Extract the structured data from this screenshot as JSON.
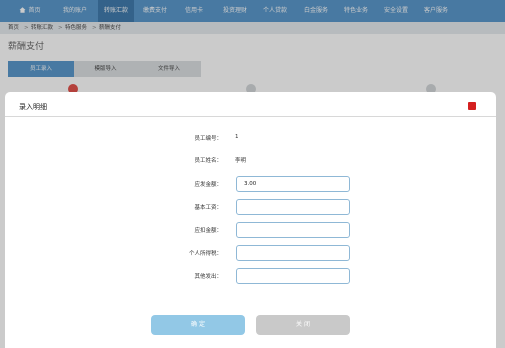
{
  "nav": {
    "items": [
      {
        "label": "首页",
        "icon": "home-icon"
      },
      {
        "label": "我的账户"
      },
      {
        "label": "转账汇款",
        "active": true
      },
      {
        "label": "缴费支付"
      },
      {
        "label": "信用卡"
      },
      {
        "label": "投资理财"
      },
      {
        "label": "个人贷款"
      },
      {
        "label": "白金服务"
      },
      {
        "label": "特色业务"
      },
      {
        "label": "安全设置"
      },
      {
        "label": "客户服务"
      }
    ]
  },
  "breadcrumb": [
    "首页",
    "转账汇款",
    "特色服务",
    "薪酬支付"
  ],
  "page": {
    "title": "薪酬支付",
    "tabs": [
      "员工录入",
      "模版导入",
      "文件导入"
    ]
  },
  "modal": {
    "title": "录入明细",
    "fields": {
      "employee_id": {
        "label": "员工编号：",
        "value": "1"
      },
      "employee_name": {
        "label": "员工姓名：",
        "value": "李明"
      },
      "gross_pay": {
        "label": "应发金额：",
        "value": "3.00"
      },
      "base_salary": {
        "label": "基本工资：",
        "value": ""
      },
      "deduction": {
        "label": "应扣金额：",
        "value": ""
      },
      "income_tax": {
        "label": "个人所得税：",
        "value": ""
      },
      "other_pay": {
        "label": "其他发出：",
        "value": ""
      }
    },
    "confirm_label": "确 定",
    "cancel_label": "关 闭"
  },
  "colors": {
    "nav_bg": "#4a8ec6",
    "nav_active": "#2e6ea5",
    "input_border": "#8fb8d6",
    "confirm_bg": "#92c8e6",
    "cancel_bg": "#c9c9c9",
    "close_red": "#d42020"
  }
}
